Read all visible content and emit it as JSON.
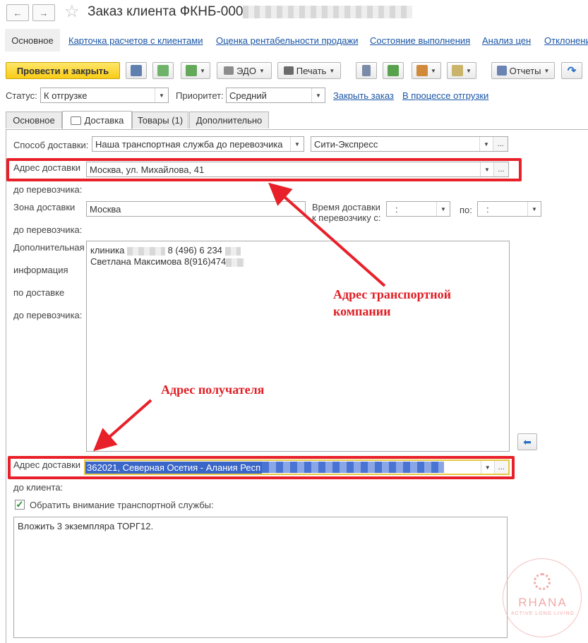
{
  "window": {
    "title_prefix": "Заказ клиента ФКНБ-000",
    "back_icon": "←",
    "forward_icon": "→",
    "star_icon": "☆"
  },
  "nav": {
    "main_tab": "Основное",
    "links": [
      "Карточка расчетов с клиентами",
      "Оценка рентабельности продажи",
      "Состояние выполнения",
      "Анализ цен",
      "Отклонени"
    ]
  },
  "toolbar": {
    "post_close": "Провести и закрыть",
    "edo": "ЭДО",
    "print": "Печать",
    "reports": "Отчеты"
  },
  "status_row": {
    "status_label": "Статус:",
    "status_value": "К отгрузке",
    "priority_label": "Приоритет:",
    "priority_value": "Средний",
    "close_order_link": "Закрыть заказ",
    "in_shipping_link": "В процессе отгрузки"
  },
  "tabs": {
    "main": "Основное",
    "delivery": "Доставка",
    "goods": "Товары (1)",
    "additional": "Дополнительно"
  },
  "delivery": {
    "method_label": "Способ доставки:",
    "method_value": "Наша транспортная служба до перевозчика",
    "carrier_value": "Сити-Экспресс",
    "carrier_address_label_1": "Адрес доставки",
    "carrier_address_label_2": "до перевозчика:",
    "carrier_address_value": "Москва, ул. Михайлова, 41",
    "zone_label_1": "Зона доставки",
    "zone_label_2": "до перевозчика:",
    "zone_value": "Москва",
    "time_label_1": "Время доставки",
    "time_label_2": "к перевозчику с:",
    "time_from_value": ":",
    "time_to_label": "по:",
    "time_to_value": ":",
    "extra_label_1": "Дополнительная",
    "extra_label_2": "информация",
    "extra_label_3": "по доставке",
    "extra_label_4": "до перевозчика:",
    "extra_line1_a": "клиника",
    "extra_line1_b": "8 (496) 6 234",
    "extra_line2": "Светлана Максимова 8(916)474",
    "client_address_label_1": "Адрес доставки",
    "client_address_label_2": "до клиента:",
    "client_address_value": "362021, Северная Осетия - Алания Респ",
    "attention_label": "Обратить внимание транспортной службы:",
    "attention_checked": true,
    "attention_text": "Вложить 3 экземпляра ТОРГ12."
  },
  "annotations": {
    "carrier_address_1": "Адрес транспортной",
    "carrier_address_2": "компании",
    "recipient_address": "Адрес получателя"
  },
  "watermark": {
    "brand": "RHANA",
    "tagline": "ACTIVE LONG LIVING"
  },
  "colors": {
    "accent_yellow": "#f8cc16",
    "link_blue": "#1a56a6",
    "annotation_red": "#e01e24"
  }
}
